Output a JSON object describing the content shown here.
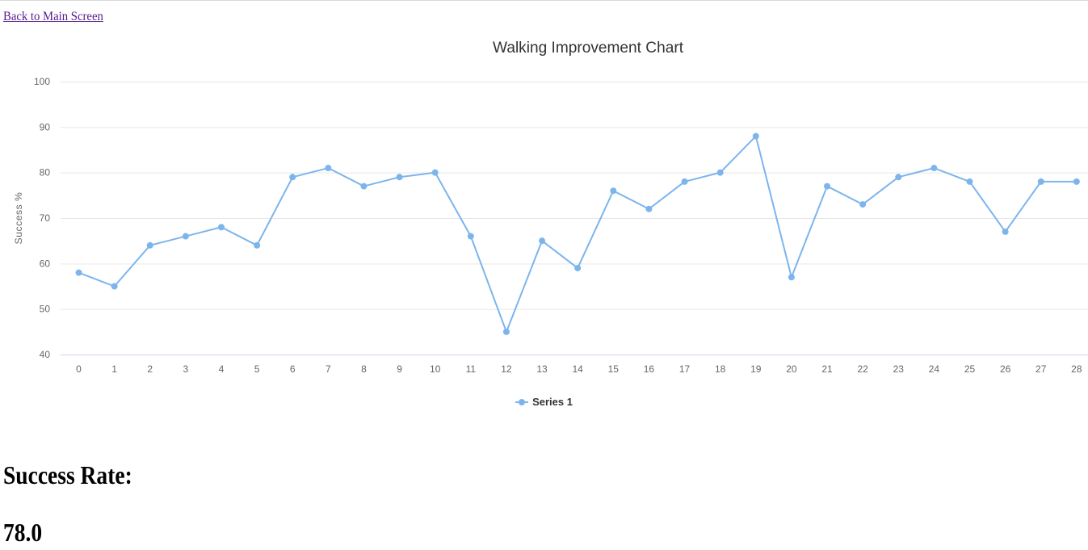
{
  "nav": {
    "back_label": "Back to Main Screen"
  },
  "chart_data": {
    "type": "line",
    "title": "Walking Improvement Chart",
    "xlabel": "",
    "ylabel": "Success %",
    "ylim": [
      40,
      100
    ],
    "yticks": [
      40,
      50,
      60,
      70,
      80,
      90,
      100
    ],
    "grid": true,
    "legend": "bottom-center",
    "color": "#7cb5ec",
    "x": [
      0,
      1,
      2,
      3,
      4,
      5,
      6,
      7,
      8,
      9,
      10,
      11,
      12,
      13,
      14,
      15,
      16,
      17,
      18,
      19,
      20,
      21,
      22,
      23,
      24,
      25,
      26,
      27,
      28
    ],
    "series": [
      {
        "name": "Series 1",
        "values": [
          58,
          55,
          64,
          66,
          68,
          64,
          79,
          81,
          77,
          79,
          80,
          66,
          45,
          65,
          59,
          76,
          72,
          78,
          80,
          88,
          57,
          77,
          73,
          79,
          81,
          78,
          67,
          78,
          78
        ]
      }
    ]
  },
  "stats": {
    "heading": "Success Rate:",
    "value": "78.0"
  }
}
